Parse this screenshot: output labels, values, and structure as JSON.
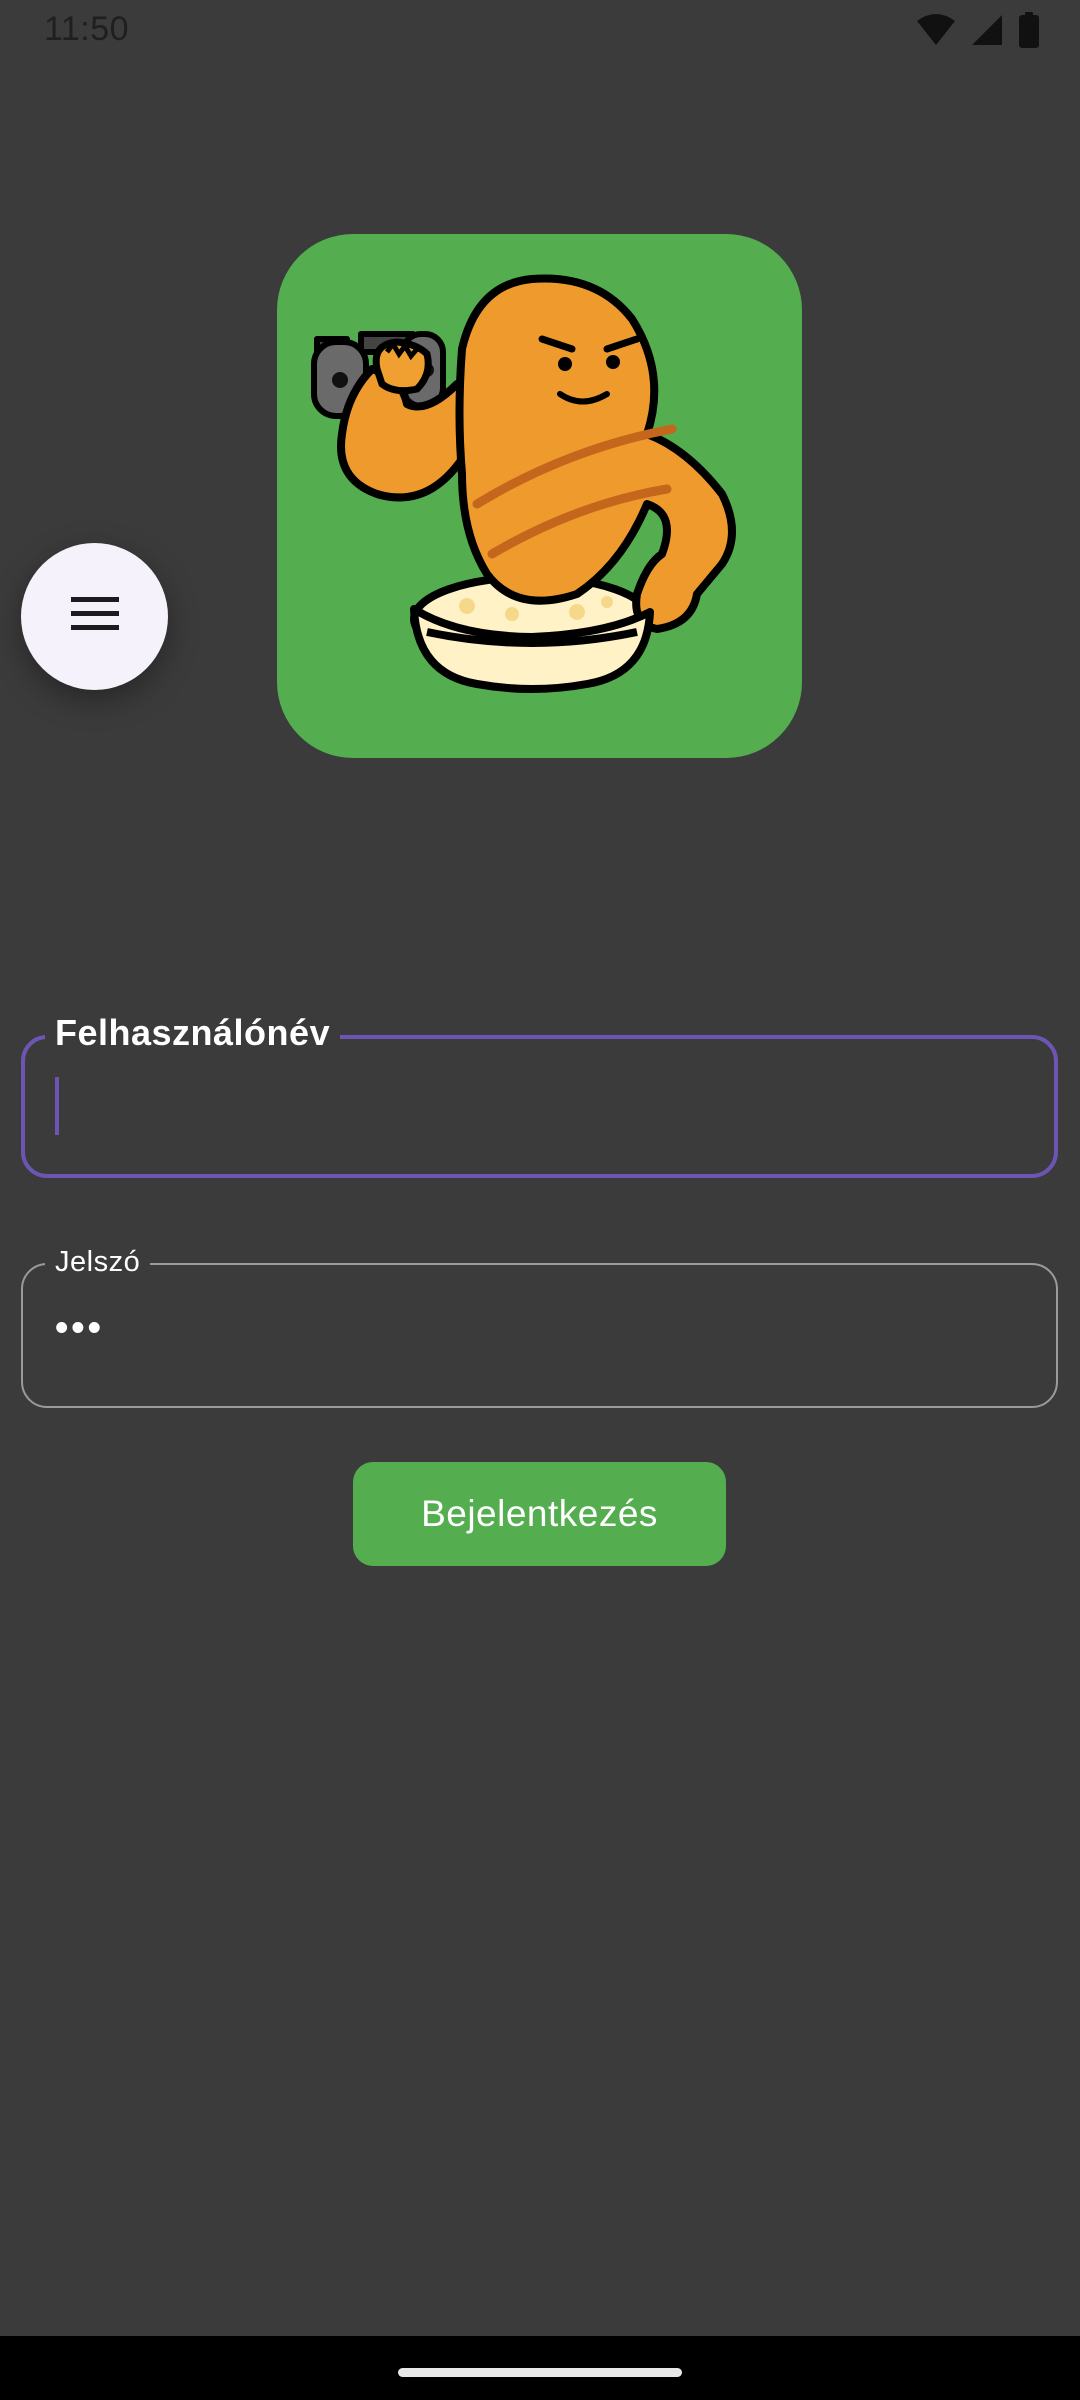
{
  "status_bar": {
    "time": "11:50",
    "icons": [
      "wifi-icon",
      "signal-icon",
      "battery-icon"
    ]
  },
  "logo": {
    "icon": "muscular-croissant-logo",
    "background_color": "#54ad4f"
  },
  "menu_button": {
    "icon": "hamburger-menu-icon"
  },
  "form": {
    "username": {
      "label": "Felhasználónév",
      "value": "",
      "focused": true
    },
    "password": {
      "label": "Jelszó",
      "value": "•••"
    },
    "login_button_label": "Bejelentkezés"
  },
  "colors": {
    "background": "#3b3b3b",
    "accent_green": "#54ad4f",
    "focus_purple": "#6d55b3",
    "fab_background": "#f6f2fb"
  }
}
